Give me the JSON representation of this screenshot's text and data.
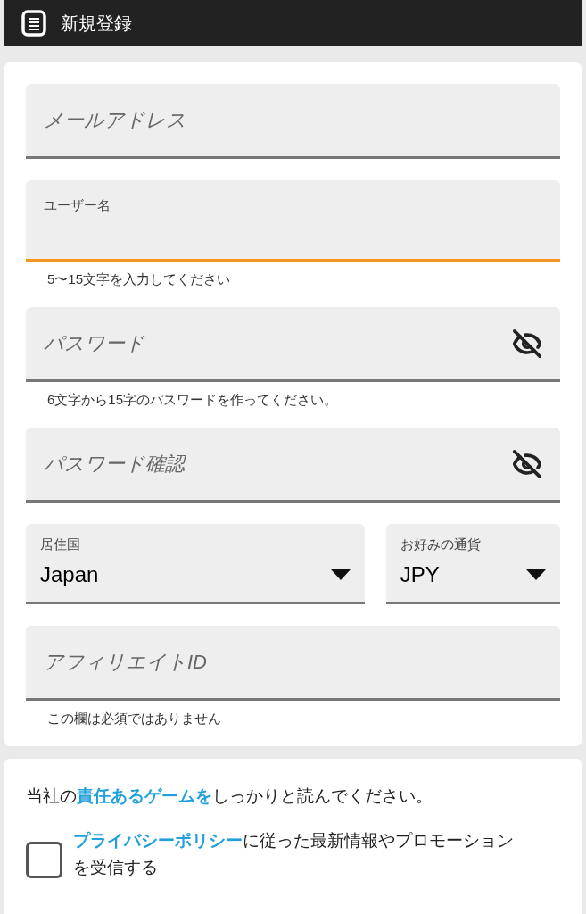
{
  "header": {
    "title": "新規登録"
  },
  "fields": [
    {
      "kind": "text",
      "placeholder": "メールアドレス",
      "focused": false
    },
    {
      "kind": "text",
      "placeholder": "ユーザー名",
      "focused": true,
      "helper": "5〜15文字を入力してください"
    },
    {
      "kind": "password",
      "placeholder": "パスワード",
      "focused": false,
      "helper": "6文字から15字のパスワードを作ってください。"
    },
    {
      "kind": "password",
      "placeholder": "パスワード確認",
      "focused": false
    },
    {
      "kind": "select",
      "label": "居住国",
      "value": "Japan"
    },
    {
      "kind": "select",
      "label": "お好みの通貨",
      "value": "JPY"
    },
    {
      "kind": "text",
      "placeholder": "アフィリエイトID",
      "focused": false,
      "helper": "この欄は必須ではありません"
    }
  ],
  "consent": {
    "notice": [
      {
        "text": "当社の",
        "link": false
      },
      {
        "text": "責任あるゲームを",
        "link": true
      },
      {
        "text": "しっかりと読んでください。",
        "link": false
      }
    ],
    "checkbox": {
      "checked": false,
      "parts": [
        {
          "text": "プライバシーポリシー",
          "link": true
        },
        {
          "text": "に従った最新情報やプロモーションを受信する",
          "link": false
        }
      ]
    }
  }
}
